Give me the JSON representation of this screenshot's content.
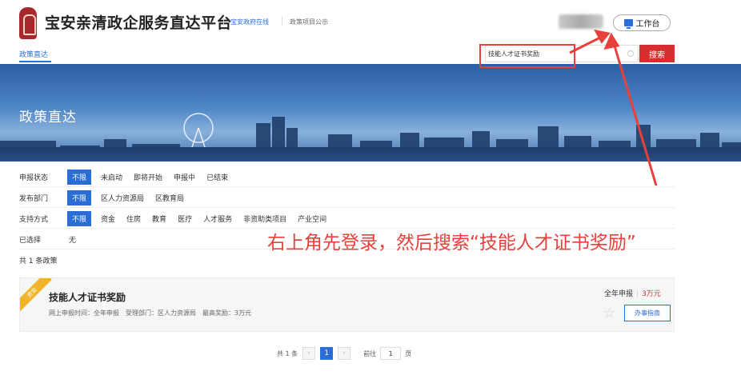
{
  "header": {
    "site_title": "宝安亲清政企服务直达平台",
    "link_online": "宝安政府在线",
    "link_notice": "政策项目公示",
    "workbench_label": "工作台"
  },
  "nav": {
    "active_tab": "政策直达"
  },
  "search": {
    "value": "技能人才证书奖励",
    "button_label": "搜索"
  },
  "banner": {
    "title": "政策直达"
  },
  "filters": {
    "status": {
      "label": "申报状态",
      "options": [
        "不限",
        "未启动",
        "即将开始",
        "申报中",
        "已结束"
      ]
    },
    "department": {
      "label": "发布部门",
      "options": [
        "不限",
        "区人力资源局",
        "区教育局"
      ]
    },
    "support": {
      "label": "支持方式",
      "options": [
        "不限",
        "资金",
        "住房",
        "教育",
        "医疗",
        "人才服务",
        "非资助类项目",
        "产业空间"
      ]
    },
    "selected": {
      "label": "已选择",
      "value": "无"
    }
  },
  "result_count": "共 1 条政策",
  "annotation": "右上角先登录，然后搜索“技能人才证书奖励”",
  "policy": {
    "badge": "资金",
    "title": "技能人才证书奖励",
    "meta": "网上申报时间：全年申报　受理部门：区人力资源局　最高奖励：3万元",
    "apply_type": "全年申报",
    "amount": "3万元",
    "guide_button": "办事指南"
  },
  "pagination": {
    "total": "共 1 条",
    "current": "1",
    "goto_label": "前往",
    "goto_value": "1",
    "page_unit": "页"
  },
  "colors": {
    "primary": "#2a6dd6",
    "accent": "#d72f2f",
    "annotation": "#e8413b",
    "badge": "#f0b429"
  }
}
